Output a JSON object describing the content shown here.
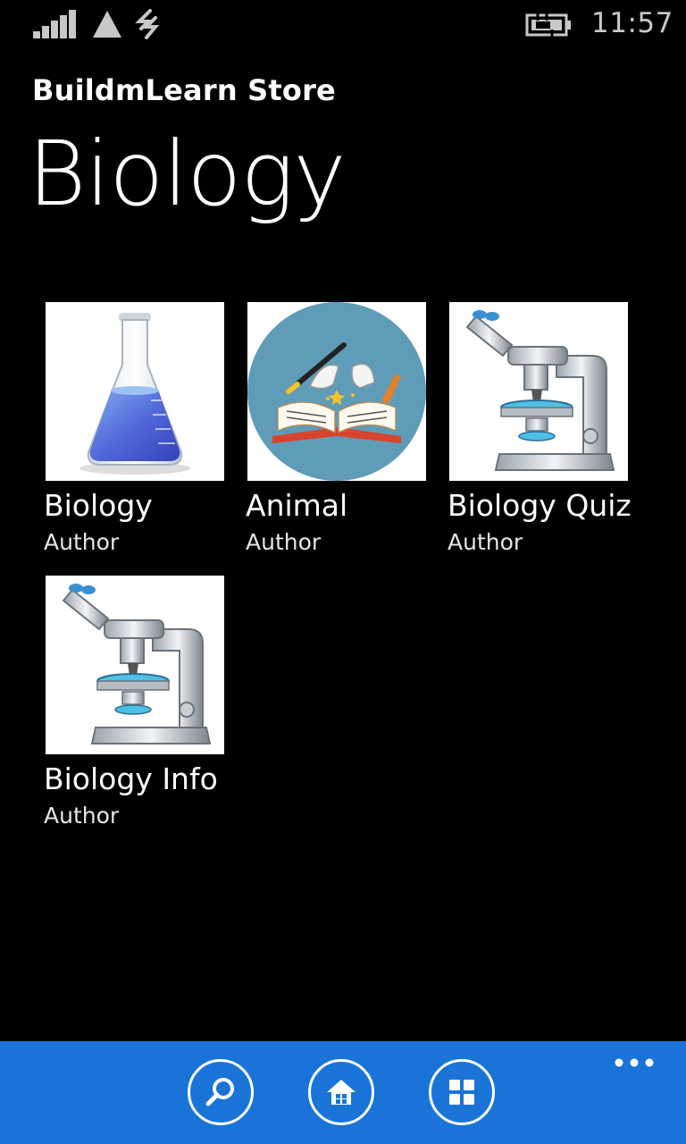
{
  "status_bar": {
    "time": "11:57",
    "icons": [
      "signal-strength-icon",
      "wifi-icon",
      "data-connection-icon",
      "battery-charging-icon"
    ]
  },
  "header": {
    "app_title": "BuildmLearn Store",
    "page_title": "Biology"
  },
  "apps": [
    {
      "name": "Biology",
      "author": "Author",
      "image": "flask-icon"
    },
    {
      "name": "Animal",
      "author": "Author",
      "image": "magic-book-icon"
    },
    {
      "name": "Biology Quiz",
      "author": "Author",
      "image": "microscope-icon"
    },
    {
      "name": "Biology Info",
      "author": "Author",
      "image": "microscope-icon"
    }
  ],
  "app_bar": {
    "buttons": [
      "search-icon",
      "home-icon",
      "grid-icon"
    ],
    "more": "more-dots-icon",
    "color": "#1a74d8"
  }
}
